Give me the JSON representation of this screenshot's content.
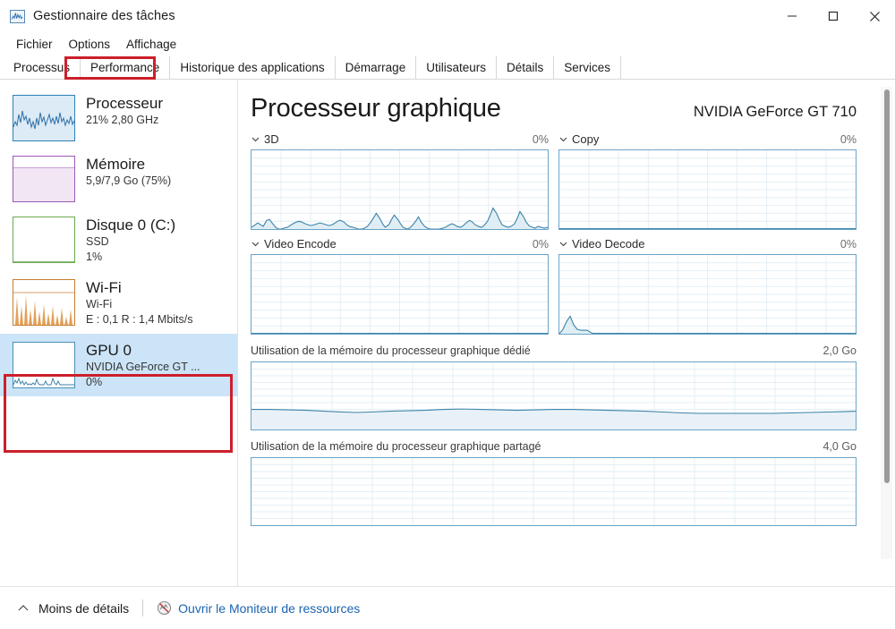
{
  "window": {
    "title": "Gestionnaire des tâches",
    "icon": "task-manager-chart-icon",
    "controls": {
      "minimize": "minimize-icon",
      "maximize": "maximize-icon",
      "close": "close-icon"
    }
  },
  "menu": {
    "items": [
      {
        "label": "Fichier"
      },
      {
        "label": "Options"
      },
      {
        "label": "Affichage"
      }
    ]
  },
  "tabs": {
    "active": "Performance",
    "items": [
      {
        "label": "Processus"
      },
      {
        "label": "Performance"
      },
      {
        "label": "Historique des applications"
      },
      {
        "label": "Démarrage"
      },
      {
        "label": "Utilisateurs"
      },
      {
        "label": "Détails"
      },
      {
        "label": "Services"
      }
    ]
  },
  "sidebar": {
    "items": [
      {
        "title": "Processeur",
        "sub1": "21%  2,80 GHz",
        "sub2": "",
        "accent": "#2f81b8",
        "fill": "#dcebf6",
        "selected": false
      },
      {
        "title": "Mémoire",
        "sub1": "5,9/7,9 Go (75%)",
        "sub2": "",
        "accent": "#9b59b6",
        "fill": "#f2e6f5",
        "selected": false
      },
      {
        "title": "Disque 0 (C:)",
        "sub1": "SSD",
        "sub2": "1%",
        "accent": "#6aa84f",
        "fill": "#ffffff",
        "selected": false
      },
      {
        "title": "Wi-Fi",
        "sub1": "Wi-Fi",
        "sub2": "E : 0,1  R : 1,4 Mbits/s",
        "accent": "#c87d2e",
        "fill": "#f7e9d8",
        "selected": false
      },
      {
        "title": "GPU 0",
        "sub1": "NVIDIA GeForce GT ...",
        "sub2": "0%",
        "accent": "#4a8fb5",
        "fill": "#eaf4fb",
        "selected": true
      }
    ]
  },
  "main": {
    "title": "Processeur graphique",
    "device": "NVIDIA GeForce GT 710",
    "graphs": [
      {
        "label": "3D",
        "value": "0%",
        "collapsible": true
      },
      {
        "label": "Copy",
        "value": "0%",
        "collapsible": true
      },
      {
        "label": "Video Encode",
        "value": "0%",
        "collapsible": true
      },
      {
        "label": "Video Decode",
        "value": "0%",
        "collapsible": true
      }
    ],
    "memory_graphs": [
      {
        "label": "Utilisation de la mémoire du processeur graphique dédié",
        "value": "2,0 Go"
      },
      {
        "label": "Utilisation de la mémoire du processeur graphique partagé",
        "value": "4,0 Go"
      }
    ],
    "scrollbar": "vertical-scrollbar"
  },
  "status": {
    "less_details": "Moins de détails",
    "less_details_icon": "chevron-up-icon",
    "resource_monitor_icon": "resource-monitor-icon",
    "resource_monitor": "Ouvrir le Moniteur de ressources"
  },
  "colors": {
    "accent_blue": "#1b63b0",
    "graph_line": "#3d83a8",
    "graph_fill": "#dfeef5",
    "grid": "#d9e7ef",
    "selection": "#cce4f7",
    "annotation_red": "#cc1f2b"
  },
  "chart_data": [
    {
      "type": "area",
      "title": "3D",
      "ylabel": "%",
      "ylim": [
        0,
        100
      ],
      "values": [
        2,
        5,
        9,
        6,
        4,
        10,
        11,
        7,
        2,
        0,
        0,
        1,
        2,
        4,
        6,
        8,
        9,
        8,
        6,
        5,
        4,
        5,
        6,
        7,
        6,
        5,
        4,
        5,
        7,
        9,
        11,
        12,
        10,
        7,
        5,
        3,
        2,
        1,
        0,
        0,
        1,
        3,
        8,
        14,
        18,
        13,
        7,
        3,
        6,
        12,
        17,
        13,
        8,
        3,
        0,
        1,
        4,
        10,
        14,
        9,
        4,
        1,
        0,
        0,
        0,
        0,
        1,
        2,
        4,
        6,
        5,
        3,
        2,
        4,
        7,
        10,
        8,
        5,
        3,
        2,
        4,
        9,
        16,
        24,
        19,
        12,
        6,
        3,
        2,
        3,
        6,
        12,
        19,
        14,
        8,
        4,
        2,
        1,
        3,
        2
      ]
    },
    {
      "type": "area",
      "title": "Copy",
      "ylabel": "%",
      "ylim": [
        0,
        100
      ],
      "values": [
        0,
        0,
        0,
        0,
        0,
        0,
        0,
        0,
        0,
        0,
        0,
        0,
        0,
        0,
        0,
        0,
        0,
        0,
        0,
        0,
        0,
        0,
        0,
        0,
        0,
        0,
        0,
        0,
        0,
        0,
        0,
        0,
        0,
        0,
        0,
        0,
        0,
        0,
        0,
        0,
        0,
        0,
        0,
        0,
        0,
        0,
        0,
        0,
        0,
        0,
        0,
        0,
        0,
        0,
        0,
        0,
        0,
        0,
        0,
        0,
        0,
        0,
        0,
        0,
        0,
        0,
        0,
        0,
        0,
        0,
        0,
        0,
        0,
        0,
        0,
        0,
        0,
        0,
        0,
        0,
        0,
        0,
        0,
        0,
        0,
        0,
        0,
        0,
        0,
        0,
        0,
        0,
        0,
        0,
        0,
        0,
        0,
        0,
        0,
        0
      ]
    },
    {
      "type": "area",
      "title": "Video Encode",
      "ylabel": "%",
      "ylim": [
        0,
        100
      ],
      "values": [
        0,
        0,
        0,
        0,
        0,
        0,
        0,
        0,
        0,
        0,
        0,
        0,
        0,
        0,
        0,
        0,
        0,
        0,
        0,
        0,
        0,
        0,
        0,
        0,
        0,
        0,
        0,
        0,
        0,
        0,
        0,
        0,
        0,
        0,
        0,
        0,
        0,
        0,
        0,
        0,
        0,
        0,
        0,
        0,
        0,
        0,
        0,
        0,
        0,
        0,
        0,
        0,
        0,
        0,
        0,
        0,
        0,
        0,
        0,
        0,
        0,
        0,
        0,
        0,
        0,
        0,
        0,
        0,
        0,
        0,
        0,
        0,
        0,
        0,
        0,
        0,
        0,
        0,
        0,
        0,
        0,
        0,
        0,
        0,
        0,
        0,
        0,
        0,
        0,
        0,
        0,
        0,
        0,
        0,
        0,
        0,
        0,
        0,
        0,
        0
      ]
    },
    {
      "type": "area",
      "title": "Video Decode",
      "ylabel": "%",
      "ylim": [
        0,
        100
      ],
      "values": [
        0,
        6,
        16,
        11,
        6,
        5,
        5,
        5,
        4,
        2,
        0,
        0,
        0,
        0,
        0,
        0,
        0,
        0,
        0,
        0,
        0,
        0,
        0,
        0,
        0,
        0,
        0,
        0,
        0,
        0,
        0,
        0,
        0,
        0,
        0,
        0,
        0,
        0,
        0,
        0,
        0,
        0,
        0,
        0,
        0,
        0,
        0,
        0,
        0,
        0,
        0,
        0,
        0,
        0,
        0,
        0,
        0,
        0,
        0,
        0,
        0,
        0,
        0,
        0,
        0,
        0,
        0,
        0,
        0,
        0,
        0,
        0,
        0,
        0,
        0,
        0,
        0,
        0,
        0,
        0,
        0,
        0,
        0,
        0,
        0,
        0,
        0,
        0,
        0,
        0,
        0,
        0,
        0,
        0,
        0,
        0,
        0,
        0,
        0,
        0
      ]
    },
    {
      "type": "area",
      "title": "Utilisation de la mémoire du processeur graphique dédié",
      "ylabel": "Go",
      "ylim": [
        0,
        2.0
      ],
      "values": [
        0.3,
        0.3,
        0.31,
        0.31,
        0.3,
        0.3,
        0.29,
        0.29,
        0.28,
        0.27,
        0.27,
        0.27,
        0.27,
        0.28,
        0.28,
        0.29,
        0.29,
        0.29,
        0.29,
        0.3,
        0.31,
        0.31,
        0.31,
        0.3,
        0.3,
        0.3,
        0.3,
        0.3,
        0.31,
        0.31,
        0.31,
        0.31,
        0.31,
        0.3,
        0.3,
        0.3,
        0.3,
        0.3,
        0.3,
        0.29,
        0.29,
        0.28,
        0.28,
        0.27,
        0.27,
        0.26,
        0.26,
        0.26,
        0.26,
        0.26,
        0.26,
        0.26,
        0.26,
        0.26,
        0.26,
        0.26,
        0.26,
        0.26,
        0.26,
        0.26,
        0.26,
        0.26,
        0.26,
        0.26,
        0.26,
        0.26,
        0.26,
        0.26,
        0.26,
        0.26,
        0.26,
        0.26,
        0.26,
        0.26,
        0.26,
        0.26,
        0.26,
        0.26,
        0.26,
        0.26,
        0.26,
        0.26,
        0.27,
        0.27,
        0.27,
        0.27,
        0.27,
        0.27,
        0.27,
        0.27,
        0.27,
        0.27,
        0.28,
        0.28,
        0.28,
        0.28,
        0.28,
        0.28,
        0.28,
        0.28
      ]
    },
    {
      "type": "area",
      "title": "Utilisation de la mémoire du processeur graphique partagé",
      "ylabel": "Go",
      "ylim": [
        0,
        4.0
      ],
      "values": [
        0,
        0,
        0,
        0,
        0,
        0,
        0,
        0,
        0,
        0,
        0,
        0,
        0,
        0,
        0,
        0,
        0,
        0,
        0,
        0,
        0,
        0,
        0,
        0,
        0,
        0,
        0,
        0,
        0,
        0,
        0,
        0,
        0,
        0,
        0,
        0,
        0,
        0,
        0,
        0,
        0,
        0,
        0,
        0,
        0,
        0,
        0,
        0,
        0,
        0,
        0,
        0,
        0,
        0,
        0,
        0,
        0,
        0,
        0,
        0,
        0,
        0,
        0,
        0,
        0,
        0,
        0,
        0,
        0,
        0,
        0,
        0,
        0,
        0,
        0,
        0,
        0,
        0,
        0,
        0,
        0,
        0,
        0,
        0,
        0,
        0,
        0,
        0,
        0,
        0,
        0,
        0,
        0,
        0,
        0,
        0,
        0,
        0,
        0,
        0
      ]
    }
  ]
}
